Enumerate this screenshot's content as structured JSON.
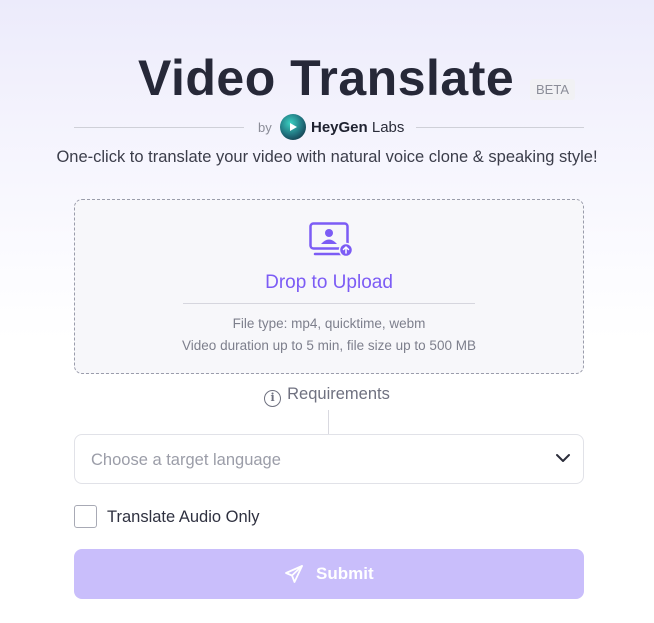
{
  "header": {
    "title": "Video Translate",
    "badge": "BETA",
    "by": "by",
    "brand_bold": "HeyGen",
    "brand_light": "Labs",
    "subtitle": "One-click to translate your video with natural voice clone & speaking style!"
  },
  "upload": {
    "icon": "upload-video-icon",
    "label": "Drop to Upload",
    "file_types": "File type: mp4, quicktime, webm",
    "limits": "Video duration up to 5 min, file size up to 500 MB"
  },
  "requirements": {
    "icon": "info-icon",
    "label": "Requirements"
  },
  "language_select": {
    "placeholder": "Choose a target language",
    "icon": "chevron-down-icon"
  },
  "audio_only": {
    "label": "Translate Audio Only",
    "checked": false
  },
  "submit": {
    "label": "Submit",
    "icon": "send-icon"
  },
  "colors": {
    "accent": "#7c5cf5",
    "submit_disabled": "#c9befb",
    "title": "#262838"
  }
}
